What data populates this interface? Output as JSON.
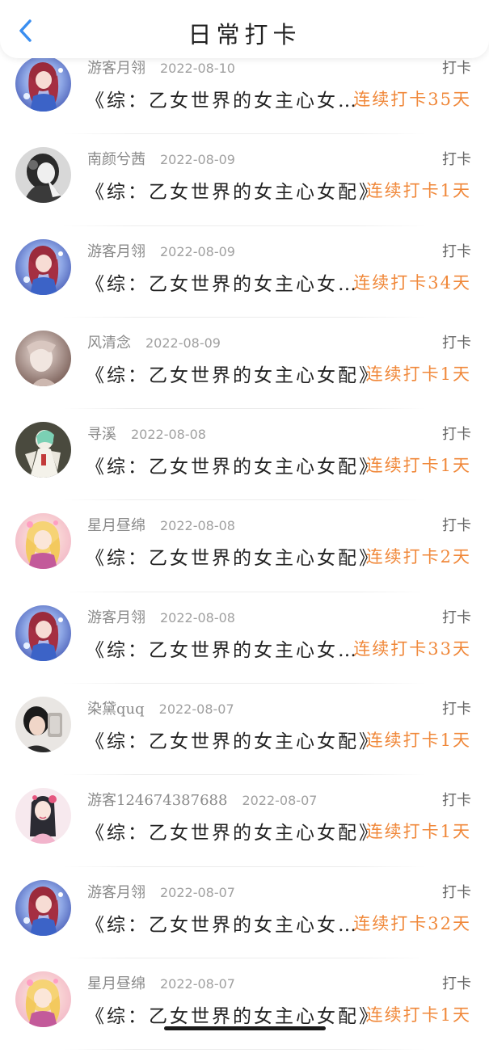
{
  "header": {
    "title": "日常打卡",
    "back_icon": "chevron-left-icon",
    "accent": "#3a8ef0"
  },
  "colors": {
    "streak": "#f0883a"
  },
  "items": [
    {
      "user": "游客月翎",
      "date": "2022-08-10",
      "tag": "打卡",
      "book": "《综：乙女世界的女主心女…",
      "streak": "连续打卡35天",
      "avatar": "anime-girl-blue"
    },
    {
      "user": "南颜兮茜",
      "date": "2022-08-09",
      "tag": "打卡",
      "book": "《综：乙女世界的女主心女配》",
      "streak": "连续打卡1天",
      "avatar": "dark-figure"
    },
    {
      "user": "游客月翎",
      "date": "2022-08-09",
      "tag": "打卡",
      "book": "《综：乙女世界的女主心女…",
      "streak": "连续打卡34天",
      "avatar": "anime-girl-blue"
    },
    {
      "user": "风清念",
      "date": "2022-08-09",
      "tag": "打卡",
      "book": "《综：乙女世界的女主心女配》",
      "streak": "连续打卡1天",
      "avatar": "pale-portrait"
    },
    {
      "user": "寻溪",
      "date": "2022-08-08",
      "tag": "打卡",
      "book": "《综：乙女世界的女主心女配》",
      "streak": "连续打卡1天",
      "avatar": "white-robe-figure"
    },
    {
      "user": "星月昼绵",
      "date": "2022-08-08",
      "tag": "打卡",
      "book": "《综：乙女世界的女主心女配》",
      "streak": "连续打卡2天",
      "avatar": "blonde-anime-girl"
    },
    {
      "user": "游客月翎",
      "date": "2022-08-08",
      "tag": "打卡",
      "book": "《综：乙女世界的女主心女…",
      "streak": "连续打卡33天",
      "avatar": "anime-girl-blue"
    },
    {
      "user": "染黛quq",
      "date": "2022-08-07",
      "tag": "打卡",
      "book": "《综：乙女世界的女主心女配》",
      "streak": "连续打卡1天",
      "avatar": "phone-selfie"
    },
    {
      "user": "游客124674387688",
      "date": "2022-08-07",
      "tag": "打卡",
      "book": "《综：乙女世界的女主心女配》",
      "streak": "连续打卡1天",
      "avatar": "pink-hanfu-girl"
    },
    {
      "user": "游客月翎",
      "date": "2022-08-07",
      "tag": "打卡",
      "book": "《综：乙女世界的女主心女…",
      "streak": "连续打卡32天",
      "avatar": "anime-girl-blue"
    },
    {
      "user": "星月昼绵",
      "date": "2022-08-07",
      "tag": "打卡",
      "book": "《综：乙女世界的女主心女配》",
      "streak": "连续打卡1天",
      "avatar": "blonde-anime-girl"
    }
  ]
}
